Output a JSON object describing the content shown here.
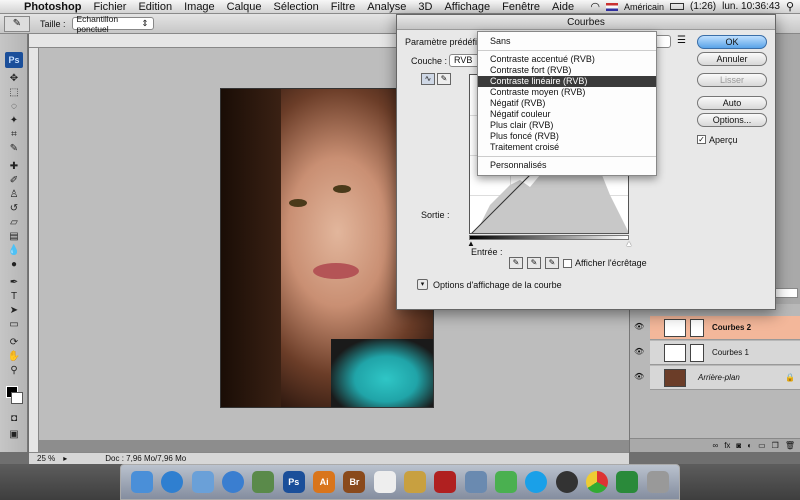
{
  "menubar": {
    "app": "Photoshop",
    "items": [
      "Fichier",
      "Edition",
      "Image",
      "Calque",
      "Sélection",
      "Filtre",
      "Analyse",
      "3D",
      "Affichage",
      "Fenêtre",
      "Aide"
    ],
    "keyboard": "Américain",
    "battery": "(1:26)",
    "clock": "lun. 10:36:43"
  },
  "optbar": {
    "size_label": "Taille :",
    "sample_select": "Echantillon ponctuel"
  },
  "dialog": {
    "title": "Courbes",
    "preset_label": "Paramètre prédéfini :",
    "channel_label": "Couche :",
    "channel_value": "RVB",
    "output_label": "Sortie :",
    "input_label": "Entrée :",
    "clipping_label": "Afficher l'écrêtage",
    "curve_options_label": "Options d'affichage de la courbe",
    "buttons": {
      "ok": "OK",
      "cancel": "Annuler",
      "smooth": "Lisser",
      "auto": "Auto",
      "options": "Options...",
      "preview": "Aperçu"
    },
    "dropdown_items": [
      "Sans",
      "Contraste accentué (RVB)",
      "Contraste fort (RVB)",
      "Contraste linéaire (RVB)",
      "Contraste moyen (RVB)",
      "Négatif (RVB)",
      "Négatif couleur",
      "Plus clair (RVB)",
      "Plus foncé (RVB)",
      "Traitement croisé",
      "Personnalisés"
    ],
    "dropdown_selected_index": 3
  },
  "status": {
    "zoom": "25 %",
    "doc": "Doc : 7,96 Mo/7,96 Mo"
  },
  "layers": [
    {
      "name": "Courbes 2",
      "selected": true
    },
    {
      "name": "Courbes 1",
      "selected": false
    },
    {
      "name": "Arrière-plan",
      "selected": false
    }
  ],
  "dock": [
    "Finder",
    "Safari",
    "Mail",
    "iTunes",
    "iPhoto",
    "Ps",
    "Ai",
    "Br",
    "iCal",
    "Aperçu",
    "Photo Booth",
    "Automator",
    "iChat",
    "Skype",
    "Dashboard",
    "Chrome",
    "Excel",
    "Corbeille"
  ]
}
